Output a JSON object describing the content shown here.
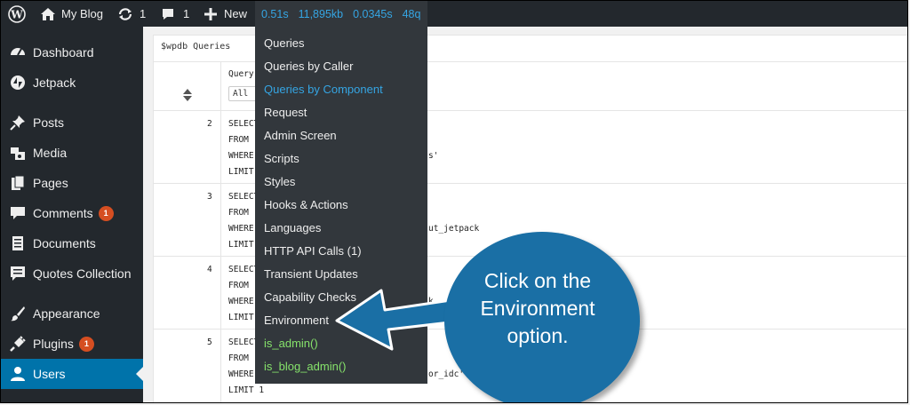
{
  "adminbar": {
    "site_name": "My Blog",
    "updates_count": "1",
    "comments_count": "1",
    "new_label": "New",
    "qm_time": "0.51s",
    "qm_memory": "11,895kb",
    "qm_db_time": "0.0345s",
    "qm_queries": "48q"
  },
  "sidebar": {
    "items": [
      {
        "label": "Dashboard"
      },
      {
        "label": "Jetpack"
      },
      {
        "label": "Posts"
      },
      {
        "label": "Media"
      },
      {
        "label": "Pages"
      },
      {
        "label": "Comments",
        "badge": "1"
      },
      {
        "label": "Documents"
      },
      {
        "label": "Quotes Collection"
      },
      {
        "label": "Appearance"
      },
      {
        "label": "Plugins",
        "badge": "1"
      },
      {
        "label": "Users"
      }
    ]
  },
  "panel": {
    "title": "$wpdb Queries",
    "query_header": "Query",
    "filter_value": "All",
    "rows": [
      {
        "num": "2",
        "l1": "SELECT",
        "l2": "FROM",
        "l3": "WHERE",
        "l3_tail": "s'",
        "l4": "LIMIT"
      },
      {
        "num": "3",
        "l1": "SELECT",
        "l2": "FROM",
        "l3": "WHERE",
        "l3_tail": "ut_jetpack",
        "l4": "LIMIT"
      },
      {
        "num": "4",
        "l1": "SELECT",
        "l2": "FROM",
        "l3": "WHERE",
        "l3_tail": "k",
        "l4": "LIMIT"
      },
      {
        "num": "5",
        "l1": "SELECT",
        "l2": "FROM",
        "l3": "WHERE",
        "l3_tail": "or_idc'",
        "l4": "LIMIT 1"
      }
    ]
  },
  "dropdown": {
    "items": [
      "Queries",
      "Queries by Caller",
      "Queries by Component",
      "Request",
      "Admin Screen",
      "Scripts",
      "Styles",
      "Hooks & Actions",
      "Languages",
      "HTTP API Calls (1)",
      "Transient Updates",
      "Capability Checks",
      "Environment",
      "is_admin()",
      "is_blog_admin()"
    ]
  },
  "callout": {
    "line1": "Click on the",
    "line2": "Environment",
    "line3": "option."
  },
  "colors": {
    "adminbar_bg": "#23282d",
    "qm_accent": "#35a5e3",
    "active_menu": "#0073aa",
    "badge": "#d54e21",
    "green_text": "#86e36b",
    "callout": "#1a6fa5"
  }
}
